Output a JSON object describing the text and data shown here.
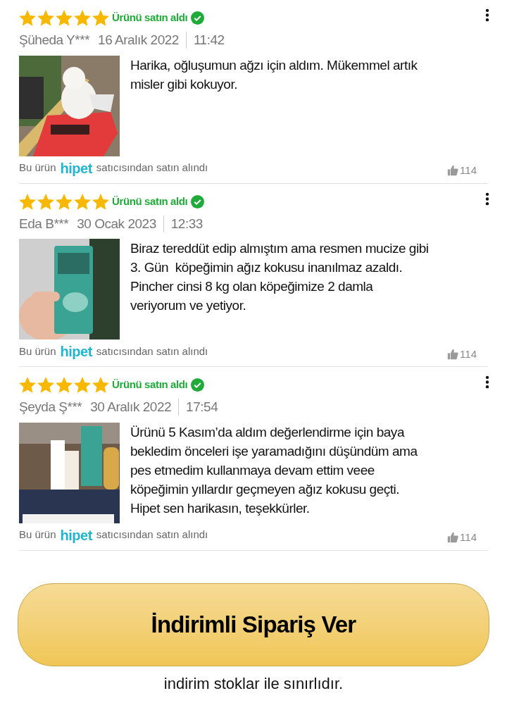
{
  "reviews": [
    {
      "stars": 5,
      "badge": "Ürünü satın aldı",
      "author": "Şüheda Y***",
      "date": "16 Aralık 2022",
      "time": "11:42",
      "text": "Harika, oğluşumun ağzı için aldım. Mükemmel artık\nmisler gibi kokuyor.",
      "seller_prefix": "Bu ürün",
      "seller": "hipet",
      "seller_suffix": "satıcısından satın alındı",
      "likes": "114"
    },
    {
      "stars": 5,
      "badge": "Ürünü satın aldı",
      "author": "Eda B***",
      "date": "30 Ocak 2023",
      "time": "12:33",
      "text": "Biraz tereddüt edip almıştım ama resmen mucize gibi\n3. Gün  köpeğimin ağız kokusu inanılmaz azaldı.\nPincher cinsi 8 kg olan köpeğimize 2 damla\nveriyorum ve yetiyor.",
      "seller_prefix": "Bu ürün",
      "seller": "hipet",
      "seller_suffix": "satıcısından satın alındı",
      "likes": "114"
    },
    {
      "stars": 5,
      "badge": "Ürünü satın aldı",
      "author": "Şeyda Ş***",
      "date": "30 Aralık 2022",
      "time": "17:54",
      "text": "Ürünü 5 Kasım’da aldım değerlendirme için baya\nbekledim önceleri işe yaramadığını düşündüm ama\npes etmedim kullanmaya devam ettim veee\nköpeğimin yıllardır geçmeyen ağız kokusu geçti.\nHipet sen harikasın, teşekkürler.",
      "seller_prefix": "Bu ürün",
      "seller": "hipet",
      "seller_suffix": "satıcısından satın alındı",
      "likes": "114"
    }
  ],
  "order_button": "İndirimli Sipariş Ver",
  "note": "indirim stoklar ile sınırlıdır."
}
